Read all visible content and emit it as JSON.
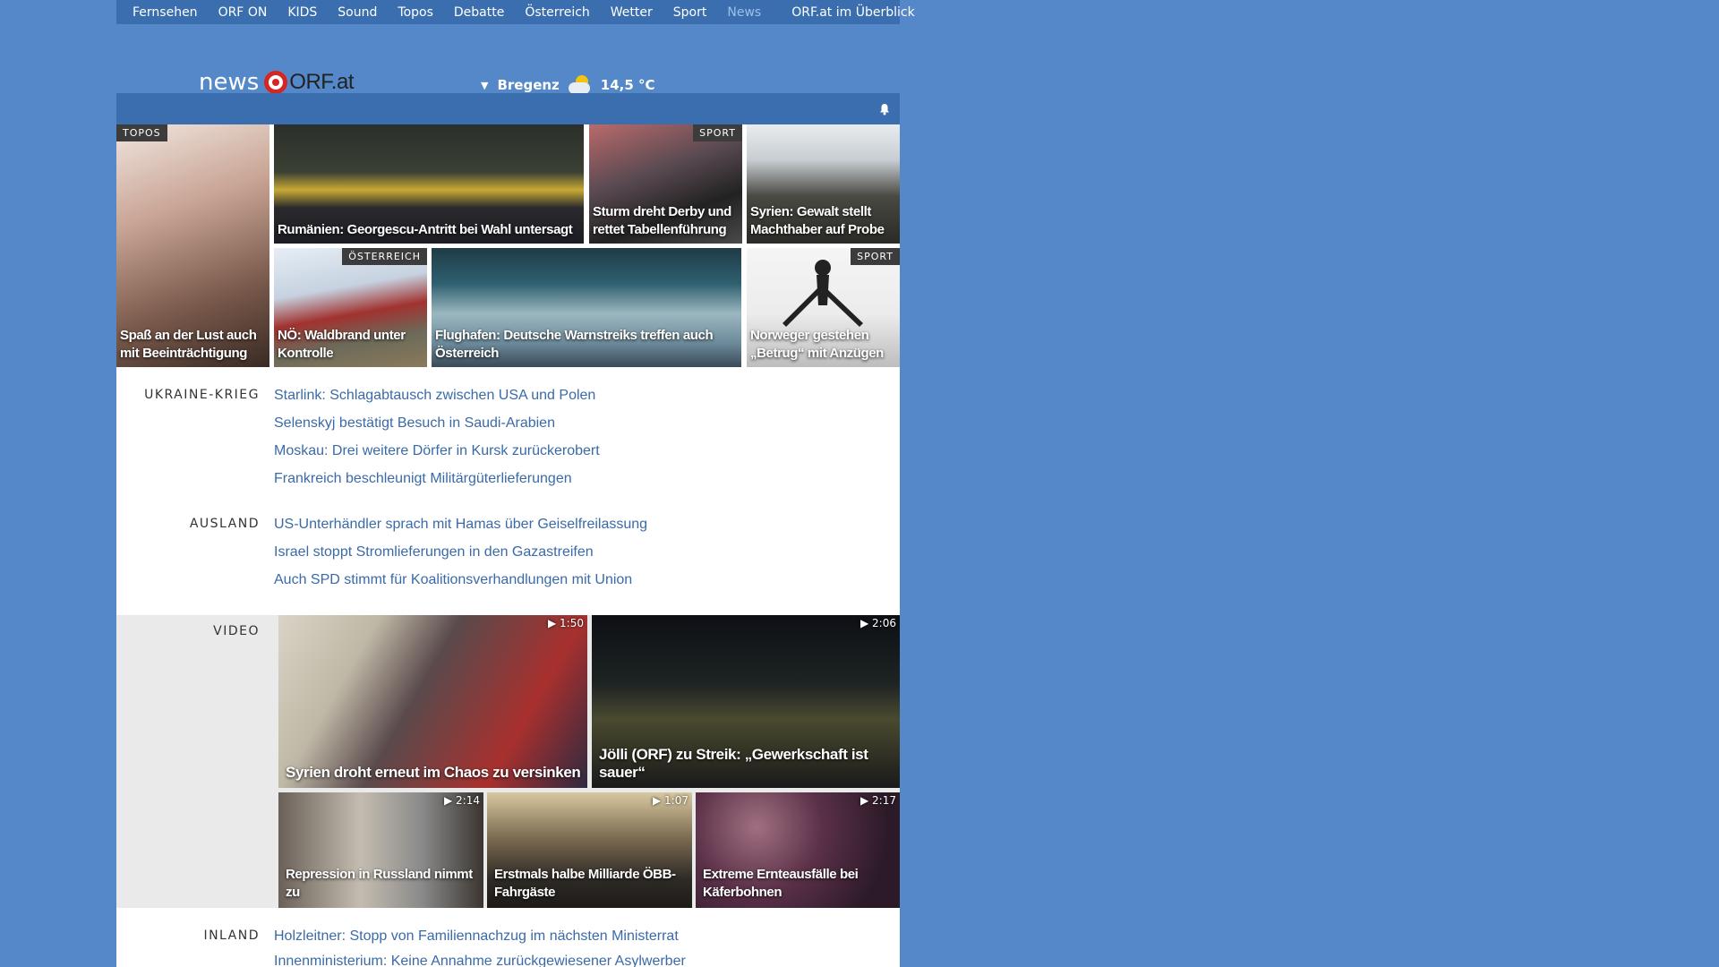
{
  "nav": {
    "items": [
      "Fernsehen",
      "ORF ON",
      "KIDS",
      "Sound",
      "Topos",
      "Debatte",
      "Österreich",
      "Wetter",
      "Sport",
      "News"
    ],
    "overview": "ORF.at im Überblick"
  },
  "logo": {
    "news": "news",
    "orf": "ORF.at"
  },
  "weather": {
    "city": "Bregenz",
    "temp": "14,5 °C",
    "icon": "sun-cloud-icon"
  },
  "tiles": [
    {
      "caption": "Spaß an der Lust auch mit Beeinträchtigung",
      "tag": "TOPOS"
    },
    {
      "caption": "Rumänien: Georgescu-Antritt bei Wahl untersagt",
      "tag": ""
    },
    {
      "caption": "Sturm dreht Derby und rettet Tabellenführung",
      "tag": "SPORT"
    },
    {
      "caption": "Syrien: Gewalt stellt Machthaber auf Probe",
      "tag": ""
    },
    {
      "caption": "NÖ: Waldbrand unter Kontrolle",
      "tag": "ÖSTERREICH"
    },
    {
      "caption": "Flughafen: Deutsche Warnstreiks treffen auch Österreich",
      "tag": ""
    },
    {
      "caption": "Norweger gestehen „Betrug“ mit Anzügen",
      "tag": "SPORT"
    }
  ],
  "sections": {
    "ukraine": {
      "label": "UKRAINE-KRIEG",
      "links": [
        "Starlink: Schlagabtausch zwischen USA und Polen",
        "Selenskyj bestätigt Besuch in Saudi-Arabien",
        "Moskau: Drei weitere Dörfer in Kursk zurückerobert",
        "Frankreich beschleunigt Militärgüterlieferungen"
      ]
    },
    "ausland": {
      "label": "AUSLAND",
      "links": [
        "US-Unterhändler sprach mit Hamas über Geiselfreilassung",
        "Israel stoppt Stromlieferungen in den Gazastreifen",
        "Auch SPD stimmt für Koalitionsverhandlungen mit Union"
      ]
    },
    "inland": {
      "label": "INLAND",
      "links": [
        "Holzleitner: Stopp von Familiennachzug im nächsten Ministerrat",
        "Innenministerium: Keine Annahme zurückgewiesener Asylwerber"
      ]
    }
  },
  "video": {
    "label": "VIDEO",
    "items": [
      {
        "caption": "Syrien droht erneut im Chaos zu versinken",
        "duration": "▶ 1:50"
      },
      {
        "caption": "Jölli (ORF) zu Streik: „Gewerkschaft ist sauer“",
        "duration": "▶ 2:06"
      },
      {
        "caption": "Repression in Russland nimmt zu",
        "duration": "▶ 2:14"
      },
      {
        "caption": "Erstmals halbe Milliarde ÖBB-Fahrgäste",
        "duration": "▶ 1:07"
      },
      {
        "caption": "Extreme Ernteausfälle bei Käferbohnen",
        "duration": "▶ 2:17"
      }
    ]
  },
  "colors": {
    "background": "#5488c8",
    "navbar": "#3a6eae",
    "link": "#3a6aa8",
    "logo_red": "#d52624"
  }
}
